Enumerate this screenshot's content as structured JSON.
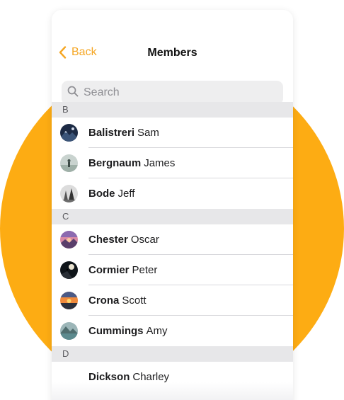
{
  "navbar": {
    "back_label": "Back",
    "title": "Members"
  },
  "search": {
    "placeholder": "Search",
    "value": ""
  },
  "colors": {
    "accent": "#f5a623",
    "backdrop_circle": "#fdac13"
  },
  "sections": [
    {
      "letter": "B",
      "members": [
        {
          "last": "Balistreri",
          "first": "Sam",
          "avatar": "avatar-mountain-night"
        },
        {
          "last": "Bergnaum",
          "first": "James",
          "avatar": "avatar-person-mist"
        },
        {
          "last": "Bode",
          "first": "Jeff",
          "avatar": "avatar-forest-bw"
        }
      ]
    },
    {
      "letter": "C",
      "members": [
        {
          "last": "Chester",
          "first": "Oscar",
          "avatar": "avatar-pink-sunset"
        },
        {
          "last": "Cormier",
          "first": "Peter",
          "avatar": "avatar-silhouette-dark"
        },
        {
          "last": "Crona",
          "first": "Scott",
          "avatar": "avatar-orange-sunset"
        },
        {
          "last": "Cummings",
          "first": "Amy",
          "avatar": "avatar-lake-mountain"
        }
      ]
    },
    {
      "letter": "D",
      "members": [
        {
          "last": "Dickson",
          "first": "Charley",
          "avatar": "avatar-blank"
        }
      ]
    }
  ]
}
